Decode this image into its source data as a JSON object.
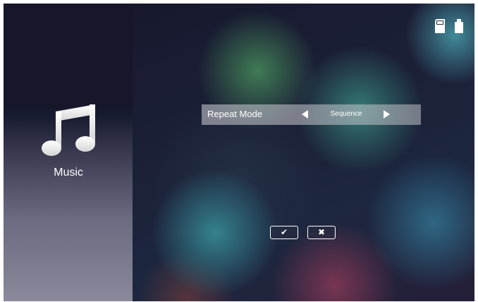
{
  "sidebar": {
    "app_label": "Music",
    "app_icon": "music-note-icon"
  },
  "status_icons": [
    "sd-card-icon",
    "usb-drive-icon"
  ],
  "settings": {
    "items": [
      {
        "label": "Repeat Mode",
        "value": "Sequence",
        "prev_icon": "arrow-left-icon",
        "next_icon": "arrow-right-icon"
      }
    ]
  },
  "dialog_buttons": {
    "confirm_icon": "checkmark-icon",
    "confirm_glyph": "✔",
    "cancel_icon": "cross-icon",
    "cancel_glyph": "✖"
  },
  "colors": {
    "text": "#ffffff",
    "setting_bar": "#c8c8cc"
  }
}
